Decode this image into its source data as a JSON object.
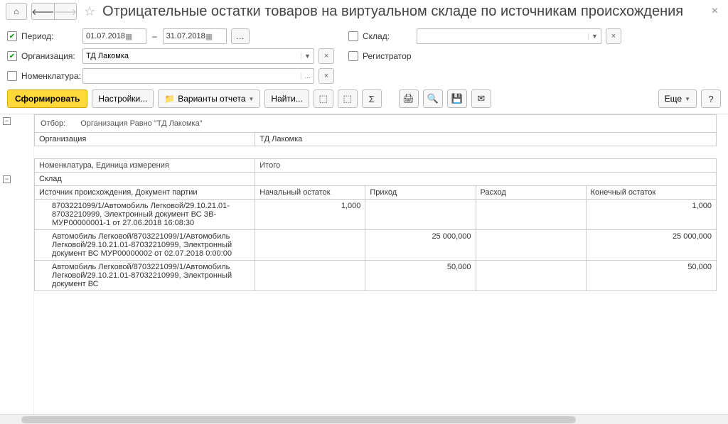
{
  "title": "Отрицательные остатки товаров на виртуальном складе по источникам происхождения",
  "filters": {
    "period_label": "Период:",
    "date_from": "01.07.2018",
    "date_to": "31.07.2018",
    "org_label": "Организация:",
    "org_value": "ТД Лакомка",
    "nomen_label": "Номенклатура:",
    "sklad_label": "Склад:",
    "registrator_label": "Регистратор"
  },
  "toolbar": {
    "form": "Сформировать",
    "settings": "Настройки...",
    "variants": "Варианты отчета",
    "find": "Найти...",
    "more": "Еще"
  },
  "report": {
    "otbor_label": "Отбор:",
    "otbor_value": "Организация Равно \"ТД Лакомка\"",
    "org_hdr": "Организация",
    "org_val": "ТД Лакомка",
    "nomen_hdr": "Номенклатура, Единица измерения",
    "itogo": "Итого",
    "sklad_hdr": "Склад",
    "ist_hdr": "Источник происхождения, Документ партии",
    "col_nach": "Начальный остаток",
    "col_prihod": "Приход",
    "col_rashod": "Расход",
    "col_kon": "Конечный остаток",
    "rows": [
      {
        "desc": "8703221099/1/Автомобиль Легковой/29.10.21.01-87032210999, Электронный документ ВС ЗВ-МУР00000001-1 от 27.06.2018 16:08:30",
        "nach": "1,000",
        "prihod": "",
        "rashod": "",
        "kon": "1,000"
      },
      {
        "desc": "Автомобиль Легковой/8703221099/1/Автомобиль Легковой/29.10.21.01-87032210999, Электронный документ ВС МУР00000002 от 02.07.2018 0:00:00",
        "nach": "",
        "prihod": "25 000,000",
        "rashod": "",
        "kon": "25 000,000"
      },
      {
        "desc": "Автомобиль Легковой/8703221099/1/Автомобиль Легковой/29.10.21.01-87032210999, Электронный документ ВС",
        "nach": "",
        "prihod": "50,000",
        "rashod": "",
        "kon": "50,000"
      }
    ]
  }
}
